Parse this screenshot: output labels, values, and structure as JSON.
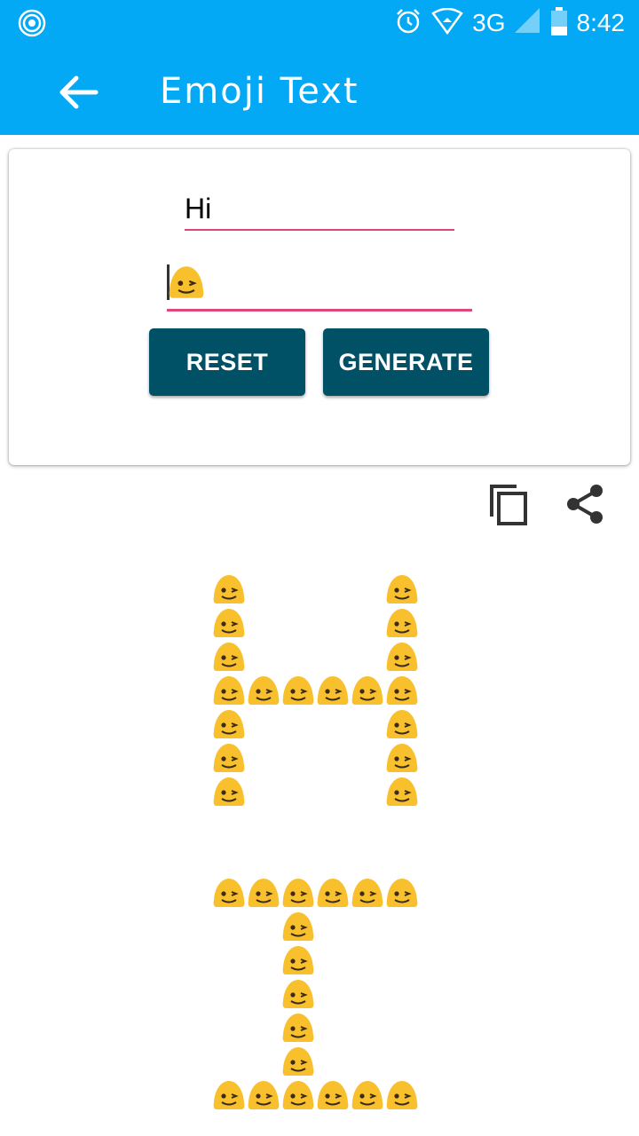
{
  "status_bar": {
    "network": "3G",
    "time": "8:42"
  },
  "toolbar": {
    "title": "Emoji Text"
  },
  "form": {
    "text_value": "Hi",
    "emoji_value": "winking-face-emoji"
  },
  "buttons": {
    "reset": "RESET",
    "generate": "GENERATE"
  },
  "output": {
    "emoji": "winking-face-emoji",
    "text": "Hi",
    "letter_rows": [
      [
        "X....X",
        "X....X",
        "X....X",
        "XXXXXX",
        "X....X",
        "X....X",
        "X....X"
      ],
      [
        "XXXXXX",
        "..X...",
        "..X...",
        "..X...",
        "..X...",
        "..X...",
        "XXXXXX"
      ]
    ]
  },
  "colors": {
    "primary": "#03a9f4",
    "accent": "#e0467a",
    "button": "#005066",
    "emoji": "#f9c02d"
  }
}
